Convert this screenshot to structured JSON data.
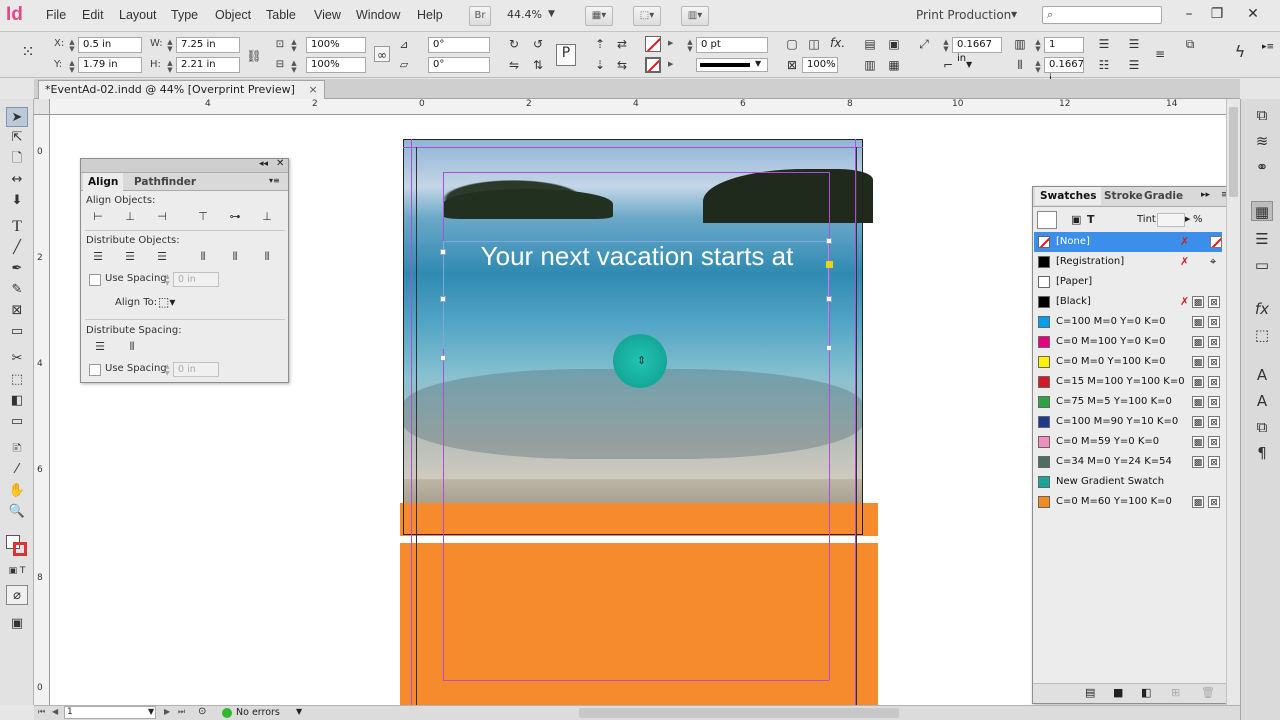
{
  "app": {
    "logo": "Id",
    "workspace": "Print Production",
    "zoom": "44.4%",
    "bridge_label": "Br"
  },
  "menu": [
    "File",
    "Edit",
    "Layout",
    "Type",
    "Object",
    "Table",
    "View",
    "Window",
    "Help"
  ],
  "control": {
    "x": "0.5 in",
    "y": "1.79 in",
    "w": "7.25 in",
    "h": "2.21 in",
    "x_label": "X:",
    "y_label": "Y:",
    "w_label": "W:",
    "h_label": "H:",
    "scale_x": "100%",
    "scale_y": "100%",
    "rotate": "0°",
    "shear": "0°",
    "stroke_weight": "0 pt",
    "opacity": "100%",
    "fx_label": "fx.",
    "offset": "0.1667 in",
    "columns": "1",
    "gutter": "0.1667 i"
  },
  "document": {
    "tab_title": "*EventAd-02.indd @ 44% [Overprint Preview]",
    "close": "×",
    "headline": "Your next vacation starts at"
  },
  "rulers": {
    "h": [
      "4",
      "2",
      "0",
      "2",
      "4",
      "6",
      "8",
      "10",
      "12",
      "14"
    ],
    "v": [
      "0",
      "2",
      "4",
      "6",
      "8",
      "0"
    ]
  },
  "align_panel": {
    "tabs": [
      "Align",
      "Pathfinder"
    ],
    "align_objects": "Align Objects:",
    "distribute_objects": "Distribute Objects:",
    "use_spacing": "Use Spacing",
    "spacing_value": "0 in",
    "align_to": "Align To:",
    "distribute_spacing": "Distribute Spacing:",
    "use_spacing2": "Use Spacing",
    "spacing_value2": "0 in"
  },
  "swatches_panel": {
    "tabs": [
      "Swatches",
      "Stroke",
      "Gradie"
    ],
    "tint_label": "Tint:",
    "tint_unit": "%",
    "items": [
      {
        "name": "[None]",
        "color": "#ffffff"
      },
      {
        "name": "[Registration]",
        "color": "#000000"
      },
      {
        "name": "[Paper]",
        "color": "#ffffff"
      },
      {
        "name": "[Black]",
        "color": "#000000"
      },
      {
        "name": "C=100 M=0 Y=0 K=0",
        "color": "#00a0e9"
      },
      {
        "name": "C=0 M=100 Y=0 K=0",
        "color": "#e4007f"
      },
      {
        "name": "C=0 M=0 Y=100 K=0",
        "color": "#fff100"
      },
      {
        "name": "C=15 M=100 Y=100 K=0",
        "color": "#d7182a"
      },
      {
        "name": "C=75 M=5 Y=100 K=0",
        "color": "#2da442"
      },
      {
        "name": "C=100 M=90 Y=10 K=0",
        "color": "#1d3a8f"
      },
      {
        "name": "C=0 M=59 Y=0 K=0",
        "color": "#f18fbf"
      },
      {
        "name": "C=34 M=0 Y=24 K=54",
        "color": "#4f6e62"
      },
      {
        "name": "New Gradient Swatch",
        "color": "#1aa59a"
      },
      {
        "name": "C=0 M=60 Y=100 K=0",
        "color": "#f18b21"
      }
    ]
  },
  "status": {
    "page": "1",
    "errors": "No errors"
  }
}
